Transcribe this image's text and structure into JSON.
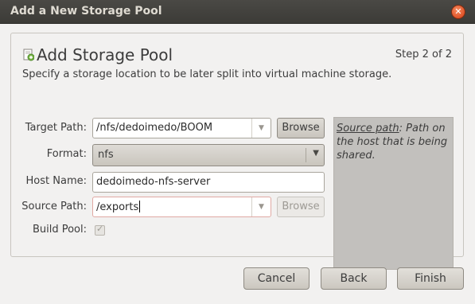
{
  "window": {
    "title": "Add a New Storage Pool",
    "close_glyph": "✕"
  },
  "header": {
    "title": "Add Storage Pool",
    "step": "Step 2 of 2",
    "subtitle": "Specify a storage location to be later split into virtual machine storage."
  },
  "form": {
    "target_path": {
      "label": "Target Path:",
      "value": "/nfs/dedoimedo/BOOM",
      "browse_label": "Browse"
    },
    "format": {
      "label": "Format:",
      "value": "nfs"
    },
    "host_name": {
      "label": "Host Name:",
      "value": "dedoimedo-nfs-server"
    },
    "source_path": {
      "label": "Source Path:",
      "value": "/exports",
      "browse_label": "Browse"
    },
    "build_pool": {
      "label": "Build Pool:",
      "checked": true
    }
  },
  "help": {
    "term": "Source path",
    "text": ": Path on the host that is being shared."
  },
  "footer": {
    "cancel_label": "Cancel",
    "back_label": "Back",
    "finish_label": "Finish"
  },
  "glyphs": {
    "dropdown_arrow": "▼",
    "check": "✓"
  },
  "colors": {
    "titlebar": "#3c3b37",
    "close_button": "#e0542a",
    "window_bg": "#f2f1f0",
    "help_bg": "#c2c0bd"
  }
}
